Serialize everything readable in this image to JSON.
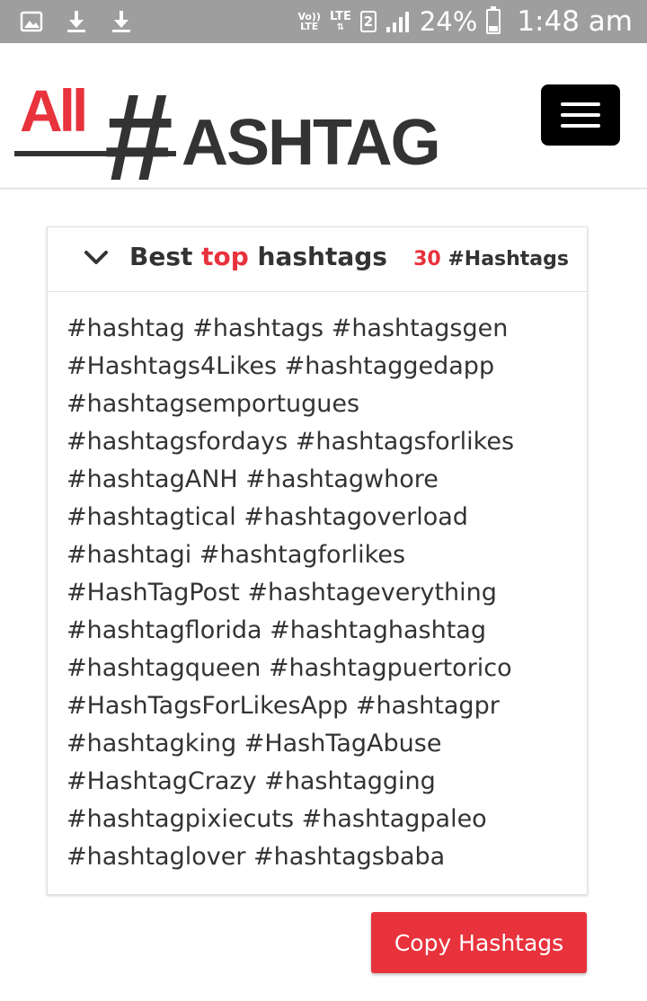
{
  "status_bar": {
    "volte": [
      "Vo))",
      "LTE"
    ],
    "network": "LTE",
    "sim_slot": "2",
    "battery_percent": "24%",
    "battery_level": 0.24,
    "time": "1:48 am",
    "icons": [
      "gallery-icon",
      "download-icon",
      "download-icon",
      "signal-icon",
      "battery-icon"
    ]
  },
  "header": {
    "logo": {
      "all": "All",
      "hash": "#",
      "rest": "ASHTAG",
      "accent_color": "#e8323c",
      "dark_color": "#333333"
    },
    "menu_icon": "hamburger-menu-icon"
  },
  "card": {
    "toggle_icon": "chevron-down-icon",
    "title_prefix": "Best ",
    "title_accent": "top",
    "title_suffix": " hashtags",
    "count": "30",
    "count_label": " #Hashtags",
    "lines": [
      "#hashtag #hashtags #hashtagsgen",
      "#Hashtags4Likes #hashtaggedapp",
      "#hashtagsemportugues",
      "#hashtagsfordays #hashtagsforlikes",
      "#hashtagANH #hashtagwhore",
      "#hashtagtical #hashtagoverload",
      "#hashtagi #hashtagforlikes",
      "#HashTagPost #hashtageverything",
      "#hashtagflorida #hashtaghashtag",
      "#hashtagqueen #hashtagpuertorico",
      "#HashTagsForLikesApp #hashtagpr",
      "#hashtagking #HashTagAbuse",
      "#HashtagCrazy #hashtagging",
      "#hashtagpixiecuts #hashtagpaleo",
      "#hashtaglover #hashtagsbaba"
    ]
  },
  "copy_button": {
    "label": "Copy Hashtags",
    "color": "#e8323c"
  }
}
